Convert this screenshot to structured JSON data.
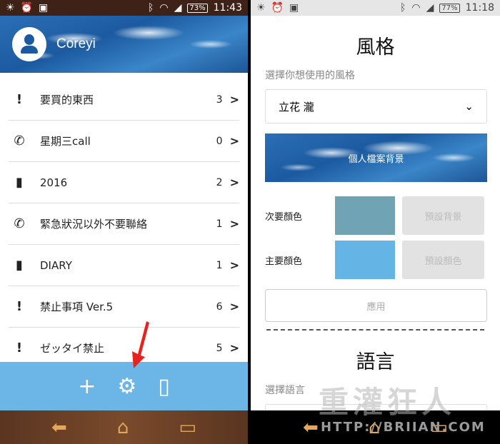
{
  "left": {
    "status": {
      "battery": "73%",
      "time": "11:43"
    },
    "user": {
      "name": "Coreyi"
    },
    "items": [
      {
        "icon": "exclamation-icon",
        "label": "要買的東西",
        "count": "3"
      },
      {
        "icon": "phone-icon",
        "label": "星期三call",
        "count": "0"
      },
      {
        "icon": "book-icon",
        "label": "2016",
        "count": "2"
      },
      {
        "icon": "phone-icon",
        "label": "緊急狀況以外不要聯絡",
        "count": "1"
      },
      {
        "icon": "book-icon",
        "label": "DIARY",
        "count": "1"
      },
      {
        "icon": "exclamation-icon",
        "label": "禁止事項 Ver.5",
        "count": "6"
      },
      {
        "icon": "exclamation-icon",
        "label": "ゼッタイ禁止",
        "count": "5"
      }
    ],
    "toolbar": {
      "add": "+",
      "settings": "⚙",
      "info": "▯"
    }
  },
  "right": {
    "status": {
      "battery": "77%",
      "time": "11:18"
    },
    "style_title": "風格",
    "style_sub": "選擇你想使用的風格",
    "style_selected": "立花 瀧",
    "banner_label": "個人檔案背景",
    "secondary_label": "次要顏色",
    "secondary_color": "#70a4b4",
    "default_bg": "預設背景",
    "primary_label": "主要顏色",
    "primary_color": "#64b4e6",
    "default_color": "預設顏色",
    "apply": "應用",
    "lang_title": "語言",
    "lang_sub": "選擇語言",
    "watermark": "重灌狂人",
    "watermark_url": "HTTP://BRIIAN.COM"
  },
  "nav": {
    "back": "⬅",
    "home": "⌂",
    "recent": "▭"
  }
}
